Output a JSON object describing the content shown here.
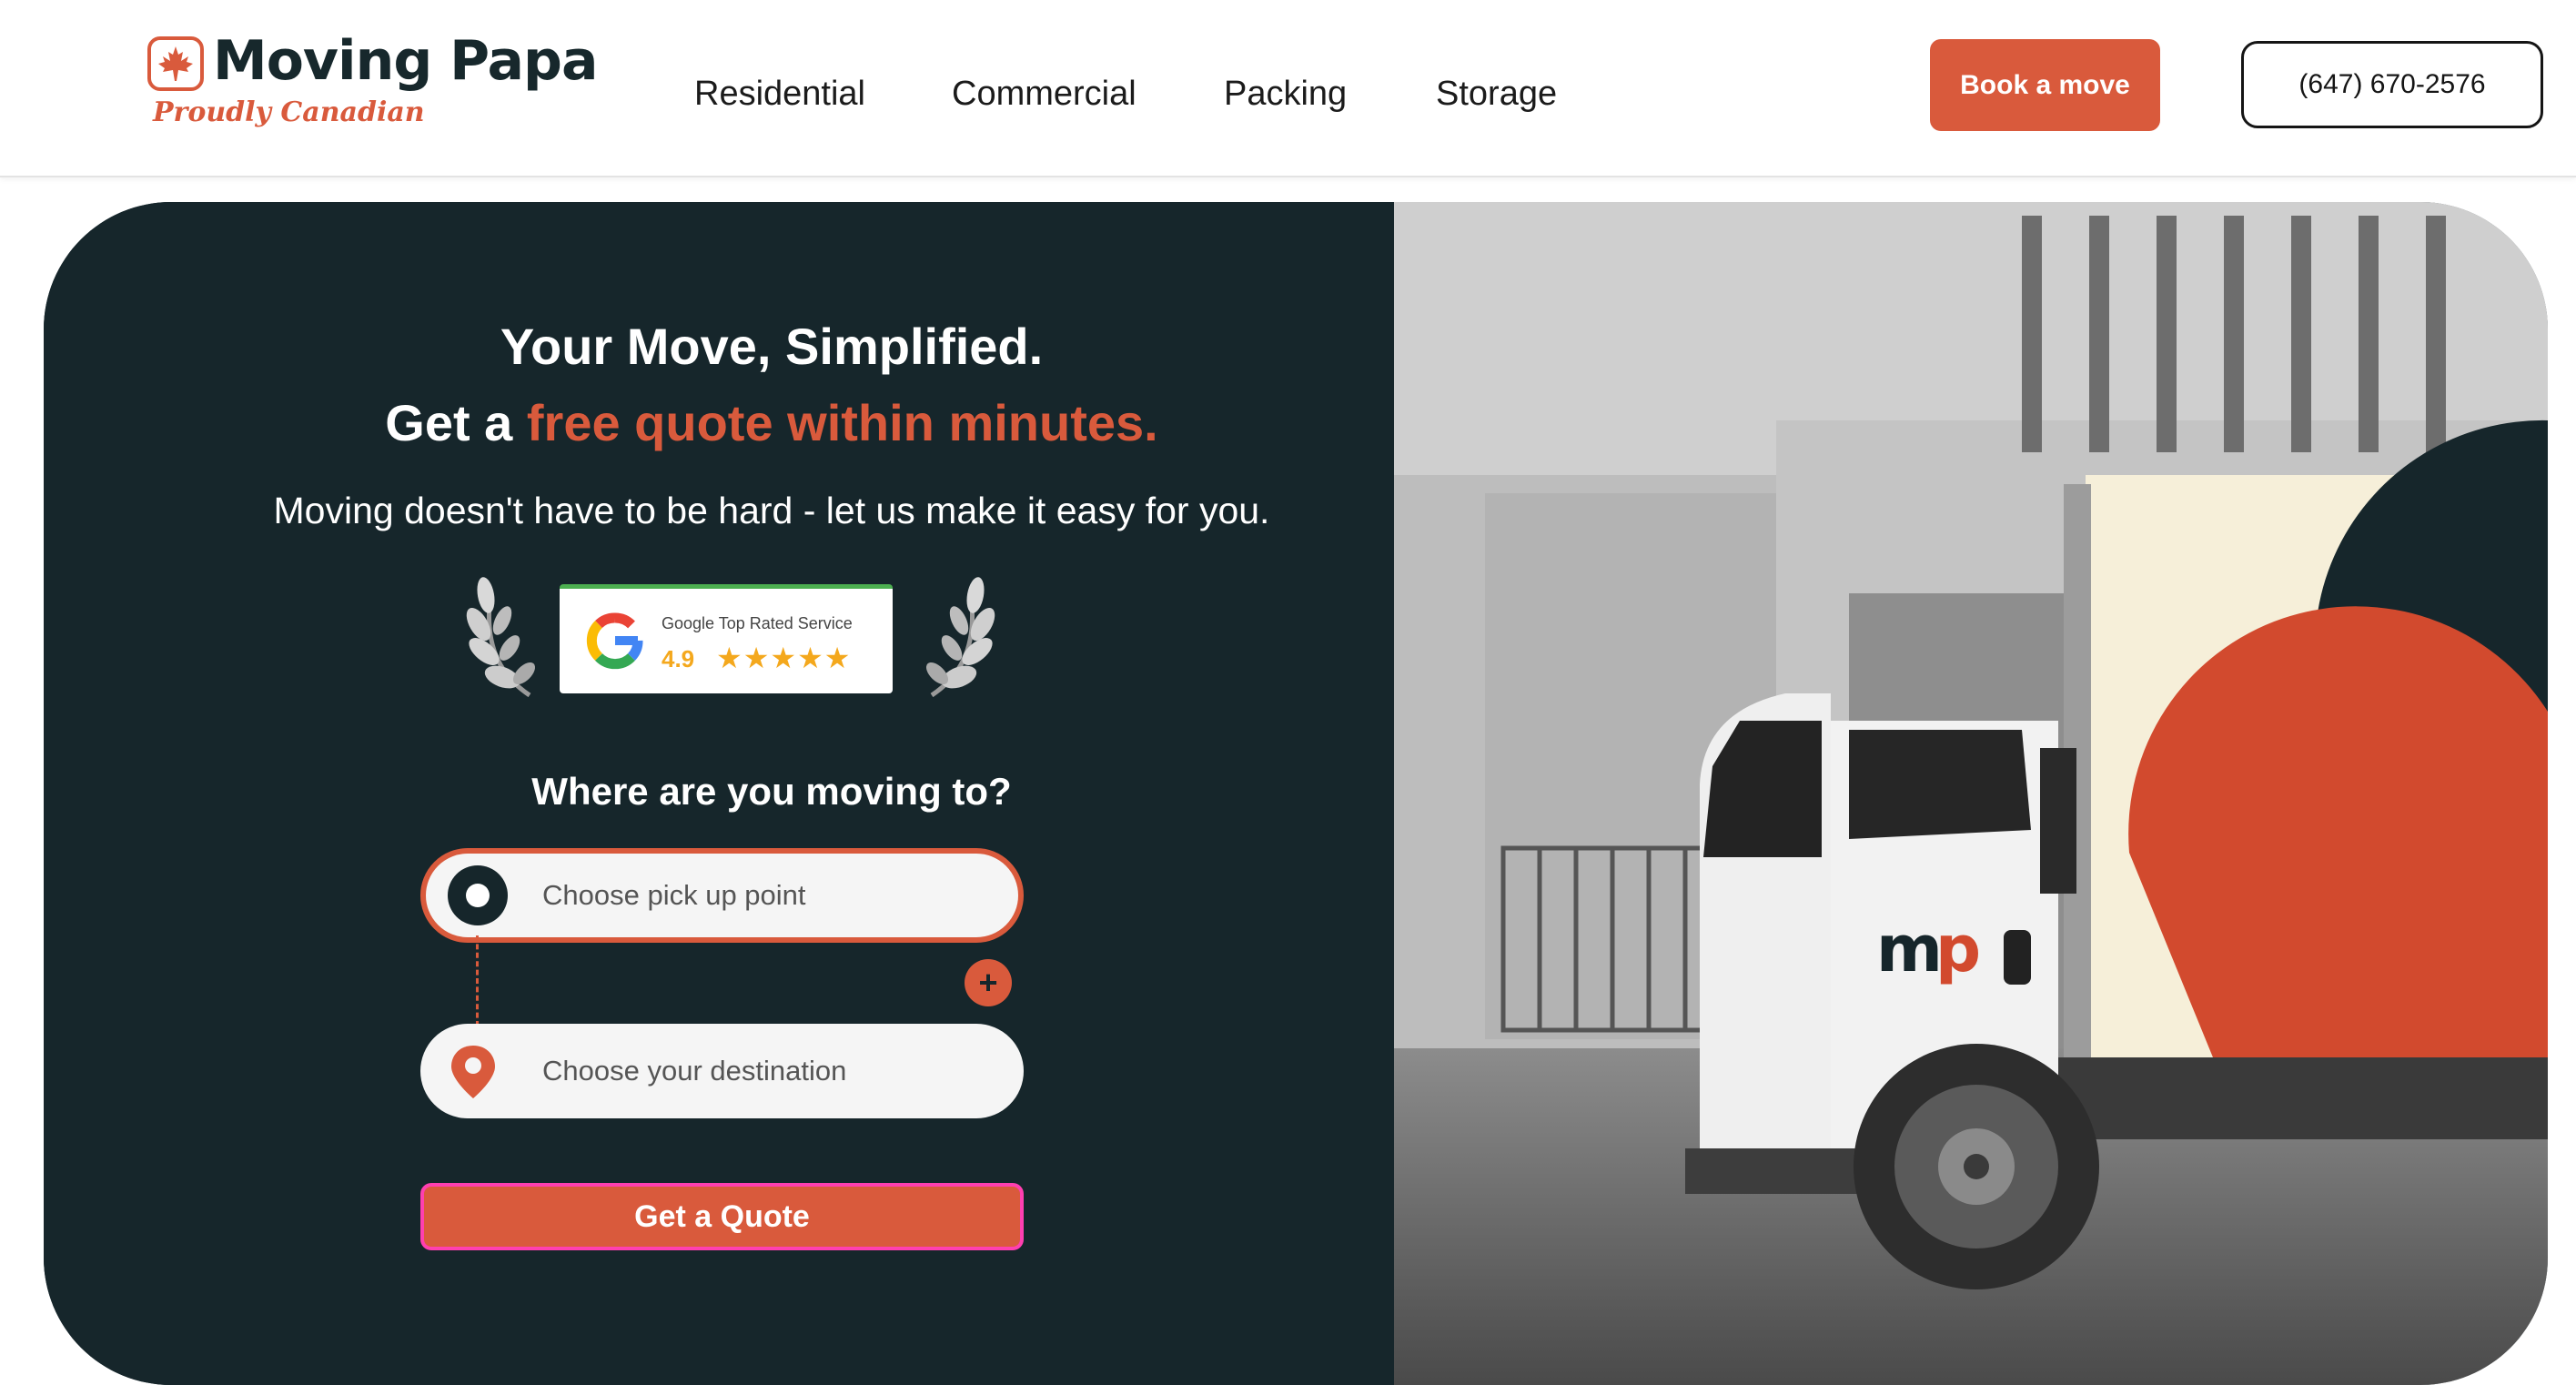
{
  "header": {
    "logo": {
      "name": "Moving Papa",
      "tagline": "Proudly Canadian"
    },
    "nav": [
      "Residential",
      "Commercial",
      "Packing",
      "Storage"
    ],
    "book_label": "Book a move",
    "phone_label": "(647) 670-2576"
  },
  "hero": {
    "headline_line1": "Your Move, Simplified.",
    "headline_line2_prefix": "Get a ",
    "headline_line2_accent": "free quote within minutes.",
    "subheadline": "Moving doesn't have to be hard - let us make it easy for you.",
    "google_badge": {
      "title": "Google Top Rated Service",
      "rating": "4.9",
      "stars": "★★★★★"
    },
    "question": "Where are you moving to?",
    "pickup_placeholder": "Choose pick up point",
    "destination_placeholder": "Choose your destination",
    "add_stop_label": "+",
    "quote_label": "Get a Quote",
    "truck_logo": "mp"
  },
  "colors": {
    "accent": "#d95a3c",
    "dark": "#16262b",
    "cream": "#f6efd9"
  }
}
